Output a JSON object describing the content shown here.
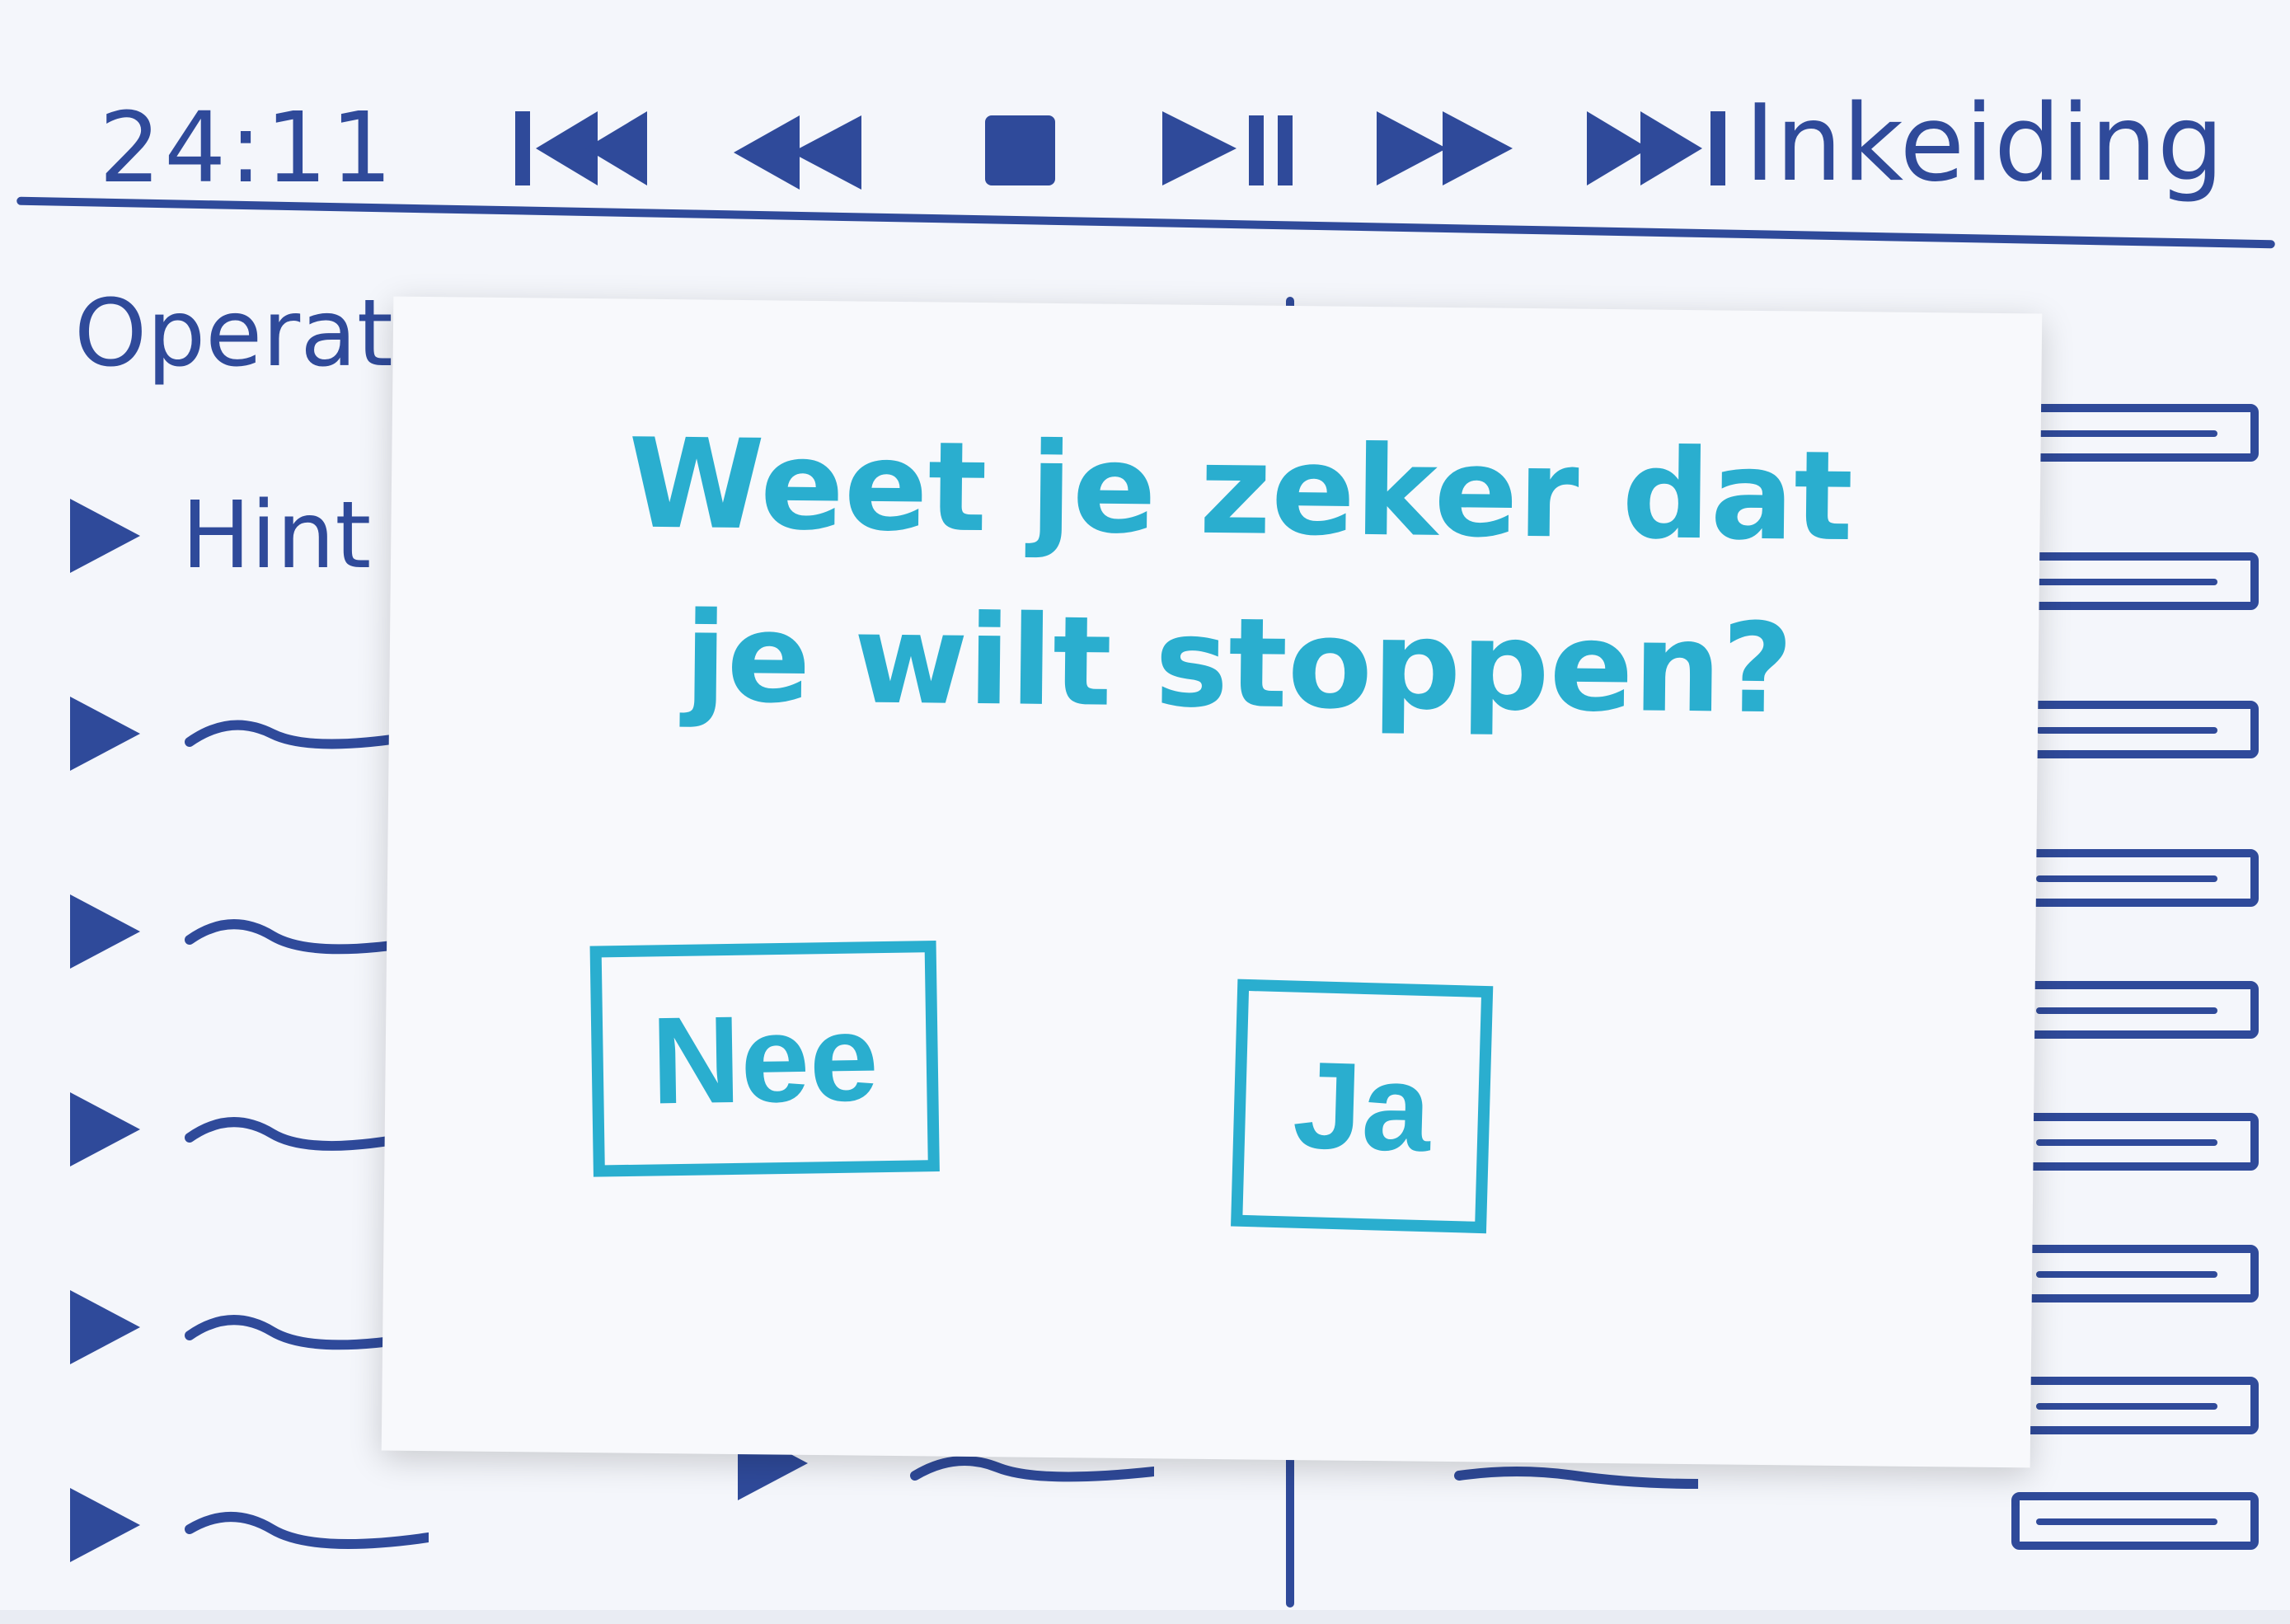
{
  "header": {
    "time": "24:11",
    "section_title": "Inkeiding",
    "controls": [
      {
        "name": "skip-to-start-icon"
      },
      {
        "name": "rewind-icon"
      },
      {
        "name": "stop-icon"
      },
      {
        "name": "play-pause-icon"
      },
      {
        "name": "fast-forward-icon"
      },
      {
        "name": "skip-to-end-icon"
      }
    ]
  },
  "left_panel": {
    "title": "Operat",
    "items": [
      {
        "label": "Hint"
      },
      {
        "label": ""
      },
      {
        "label": ""
      },
      {
        "label": ""
      },
      {
        "label": ""
      },
      {
        "label": ""
      }
    ]
  },
  "dialog": {
    "question_line1": "Weet je zeker dat",
    "question_line2": "je wilt stoppen?",
    "no_label": "Nee",
    "yes_label": "Ja"
  },
  "colors": {
    "ink_dark": "#2f4a9a",
    "ink_light": "#2aaecf",
    "paper": "#f4f6fb"
  }
}
